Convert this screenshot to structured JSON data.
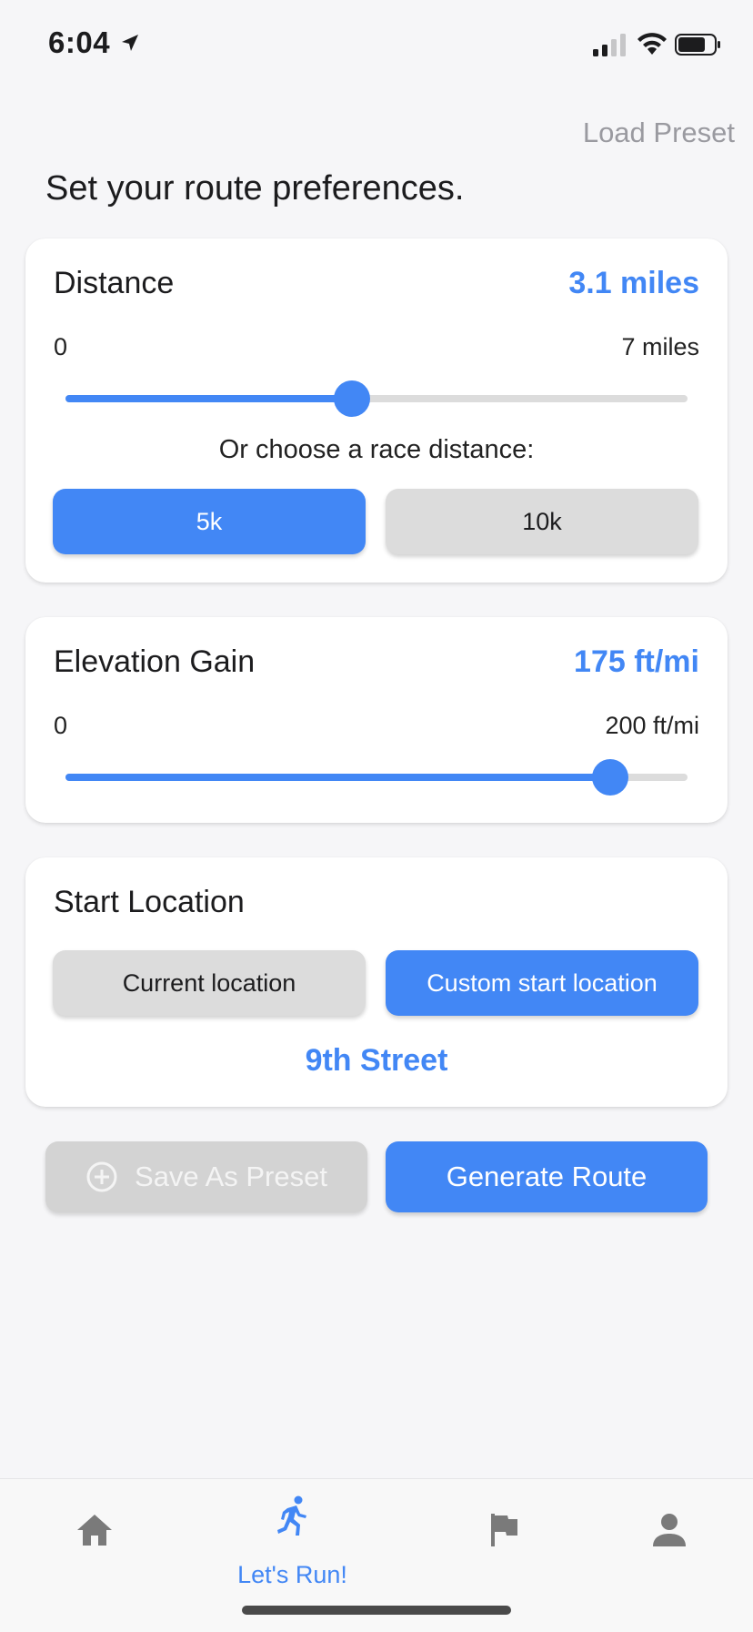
{
  "status_bar": {
    "time": "6:04"
  },
  "header": {
    "load_preset_label": "Load Preset",
    "title": "Set your route preferences."
  },
  "distance": {
    "title": "Distance",
    "value_label": "3.1 miles",
    "range_min": "0",
    "range_max": "7 miles",
    "slider_fraction": 0.46,
    "race_prompt": "Or choose a race distance:",
    "options": [
      {
        "label": "5k",
        "selected": true
      },
      {
        "label": "10k",
        "selected": false
      }
    ]
  },
  "elevation": {
    "title": "Elevation Gain",
    "value_label": "175 ft/mi",
    "range_min": "0",
    "range_max": "200 ft/mi",
    "slider_fraction": 0.875
  },
  "start_location": {
    "title": "Start Location",
    "current_label": "Current location",
    "custom_label": "Custom start location",
    "selected": "custom",
    "custom_value": "9th Street"
  },
  "actions": {
    "save_preset_label": "Save As Preset",
    "save_preset_enabled": false,
    "generate_label": "Generate Route"
  },
  "tab_bar": {
    "tabs": [
      {
        "icon": "home-icon",
        "label": ""
      },
      {
        "icon": "runner-icon",
        "label": "Let's Run!",
        "active": true
      },
      {
        "icon": "flag-icon",
        "label": ""
      },
      {
        "icon": "person-icon",
        "label": ""
      }
    ]
  },
  "colors": {
    "accent": "#4287f5",
    "inactive_button": "#dcdcdc",
    "disabled_button": "#d3d3d3",
    "tab_icon": "#7a7a7a"
  }
}
